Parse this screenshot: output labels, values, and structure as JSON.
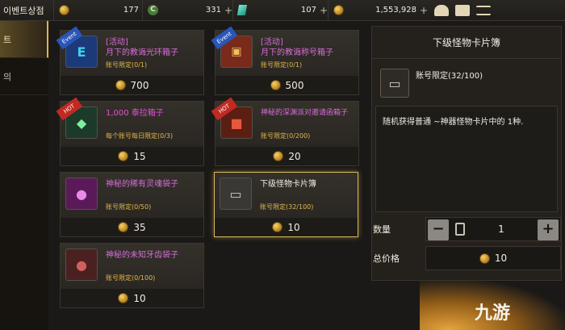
{
  "topbar": {
    "title": "이벤트상점",
    "currencies": [
      {
        "icon": "gold-coin-icon",
        "value": "177",
        "has_plus": false
      },
      {
        "icon": "c-coin-icon",
        "value": "331",
        "has_plus": true
      },
      {
        "icon": "gem-icon",
        "value": "107",
        "has_plus": true
      },
      {
        "icon": "gold-coin-icon",
        "value": "1,553,928",
        "has_plus": true
      }
    ],
    "icons": [
      "bag-icon",
      "mail-icon",
      "menu-icon"
    ]
  },
  "nav": {
    "items": [
      {
        "label": "트",
        "active": true
      },
      {
        "label": "의",
        "active": false
      }
    ]
  },
  "items": [
    {
      "tag": "Event",
      "name": "[活动]\n月下的教诲光环箱子",
      "sub": "账号限定(0/1)",
      "price": "700"
    },
    {
      "tag": "Event",
      "name": "[活动]\n月下的教诲称号箱子",
      "sub": "账号限定(0/1)",
      "price": "500"
    },
    {
      "tag": "HOT",
      "name": "1,000 泰拉箱子",
      "sub": "每个账号每日限定(0/3)",
      "price": "15"
    },
    {
      "tag": "HOT",
      "name": "神秘的深渊派对邀请函箱子",
      "sub": "账号限定(0/200)",
      "price": "20"
    },
    {
      "tag": "",
      "name": "神秘的稀有灵魂袋子",
      "sub": "账号限定(0/50)",
      "price": "35"
    },
    {
      "tag": "",
      "name": "下级怪物卡片簿",
      "sub": "账号限定(32/100)",
      "price": "10"
    },
    {
      "tag": "",
      "name": "神秘的未知牙齿袋子",
      "sub": "账号限定(0/100)",
      "price": "10"
    }
  ],
  "detail": {
    "title": "下级怪物卡片簿",
    "limit": "账号限定(32/100)",
    "description": "随机获得普通 ~神器怪物卡片中的 1种.",
    "quantity_label": "数量",
    "quantity": "1",
    "minus": "−",
    "plus": "+",
    "total_label": "总价格",
    "total": "10"
  },
  "watermark": "九游"
}
